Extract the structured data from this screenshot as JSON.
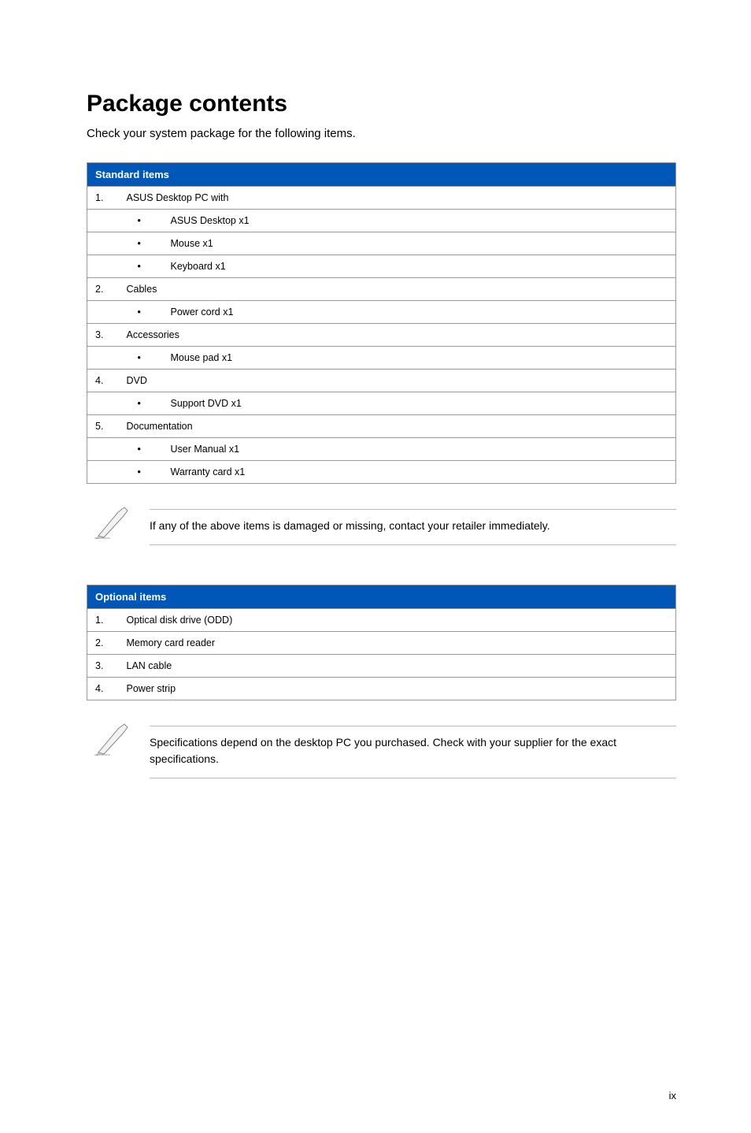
{
  "title": "Package contents",
  "intro": "Check your system package for the following items.",
  "standard": {
    "header": "Standard items",
    "groups": [
      {
        "num": "1.",
        "label": "ASUS Desktop PC with",
        "items": [
          "ASUS Desktop x1",
          "Mouse x1",
          "Keyboard x1"
        ]
      },
      {
        "num": "2.",
        "label": "Cables",
        "items": [
          "Power cord x1"
        ]
      },
      {
        "num": "3.",
        "label": "Accessories",
        "items": [
          "Mouse pad x1"
        ]
      },
      {
        "num": "4.",
        "label": "DVD",
        "items": [
          "Support DVD x1"
        ]
      },
      {
        "num": "5.",
        "label": "Documentation",
        "items": [
          "User Manual x1",
          "Warranty card x1"
        ]
      }
    ]
  },
  "note1": "If any of the above items is damaged or missing, contact your retailer immediately.",
  "optional": {
    "header": "Optional items",
    "rows": [
      {
        "num": "1.",
        "label": "Optical disk drive (ODD)"
      },
      {
        "num": "2.",
        "label": "Memory card reader"
      },
      {
        "num": "3.",
        "label": "LAN cable"
      },
      {
        "num": "4.",
        "label": "Power strip"
      }
    ]
  },
  "note2": "Specifications depend on the desktop PC you purchased. Check with your supplier for the exact specifications.",
  "pageNumber": "ix"
}
